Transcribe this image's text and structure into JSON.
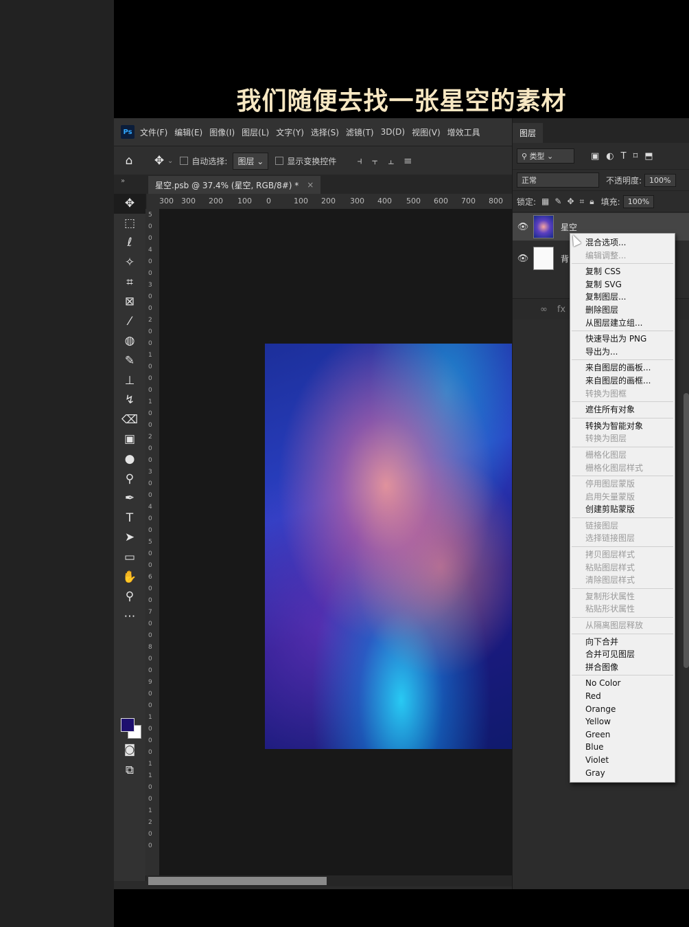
{
  "caption": "我们随便去找一张星空的素材",
  "app": {
    "logo": "Ps"
  },
  "menu": [
    "文件(F)",
    "编辑(E)",
    "图像(I)",
    "图层(L)",
    "文字(Y)",
    "选择(S)",
    "滤镜(T)",
    "3D(D)",
    "视图(V)",
    "增效工具"
  ],
  "options": {
    "auto_select_label": "自动选择:",
    "auto_select_value": "图层",
    "show_transform_label": "显示变换控件"
  },
  "doc_tab": {
    "title": "星空.psb @ 37.4% (星空, RGB/8#) *",
    "close": "×"
  },
  "ruler_top": [
    "300",
    "300",
    "200",
    "100",
    "0",
    "100",
    "200",
    "300",
    "400",
    "500",
    "600",
    "700",
    "800"
  ],
  "ruler_left": [
    "5",
    "0",
    "0",
    "4",
    "0",
    "0",
    "3",
    "0",
    "0",
    "2",
    "0",
    "0",
    "1",
    "0",
    "0",
    "0",
    "1",
    "0",
    "0",
    "2",
    "0",
    "0",
    "3",
    "0",
    "0",
    "4",
    "0",
    "0",
    "5",
    "0",
    "0",
    "6",
    "0",
    "0",
    "7",
    "0",
    "0",
    "8",
    "0",
    "0",
    "9",
    "0",
    "0",
    "1",
    "0",
    "0",
    "0",
    "1",
    "1",
    "0",
    "0",
    "1",
    "2",
    "0",
    "0"
  ],
  "layers_panel": {
    "tab": "图层",
    "filter_label": "类型",
    "blend_mode": "正常",
    "opacity_label": "不透明度:",
    "opacity_value": "100%",
    "lock_label": "锁定:",
    "fill_label": "填充:",
    "fill_value": "100%",
    "layers": [
      {
        "name": "星空"
      },
      {
        "name": "背"
      }
    ],
    "footer": [
      "∞",
      "fx"
    ]
  },
  "context_menu": [
    [
      {
        "label": "混合选项...",
        "enabled": true
      },
      {
        "label": "编辑调整...",
        "enabled": false
      }
    ],
    [
      {
        "label": "复制 CSS",
        "enabled": true
      },
      {
        "label": "复制 SVG",
        "enabled": true
      },
      {
        "label": "复制图层...",
        "enabled": true
      },
      {
        "label": "删除图层",
        "enabled": true
      },
      {
        "label": "从图层建立组...",
        "enabled": true
      }
    ],
    [
      {
        "label": "快速导出为 PNG",
        "enabled": true
      },
      {
        "label": "导出为...",
        "enabled": true
      }
    ],
    [
      {
        "label": "来自图层的画板...",
        "enabled": true
      },
      {
        "label": "来自图层的画框...",
        "enabled": true
      },
      {
        "label": "转换为图框",
        "enabled": false
      }
    ],
    [
      {
        "label": "遮住所有对象",
        "enabled": true
      }
    ],
    [
      {
        "label": "转换为智能对象",
        "enabled": true
      },
      {
        "label": "转换为图层",
        "enabled": false
      }
    ],
    [
      {
        "label": "栅格化图层",
        "enabled": false
      },
      {
        "label": "栅格化图层样式",
        "enabled": false
      }
    ],
    [
      {
        "label": "停用图层蒙版",
        "enabled": false
      },
      {
        "label": "启用矢量蒙版",
        "enabled": false
      },
      {
        "label": "创建剪贴蒙版",
        "enabled": true
      }
    ],
    [
      {
        "label": "链接图层",
        "enabled": false
      },
      {
        "label": "选择链接图层",
        "enabled": false
      }
    ],
    [
      {
        "label": "拷贝图层样式",
        "enabled": false
      },
      {
        "label": "粘贴图层样式",
        "enabled": false
      },
      {
        "label": "清除图层样式",
        "enabled": false
      }
    ],
    [
      {
        "label": "复制形状属性",
        "enabled": false
      },
      {
        "label": "粘贴形状属性",
        "enabled": false
      }
    ],
    [
      {
        "label": "从隔离图层释放",
        "enabled": false
      }
    ],
    [
      {
        "label": "向下合并",
        "enabled": true
      },
      {
        "label": "合并可见图层",
        "enabled": true
      },
      {
        "label": "拼合图像",
        "enabled": true
      }
    ],
    [
      {
        "label": "No Color",
        "enabled": true
      },
      {
        "label": "Red",
        "enabled": true
      },
      {
        "label": "Orange",
        "enabled": true
      },
      {
        "label": "Yellow",
        "enabled": true
      },
      {
        "label": "Green",
        "enabled": true
      },
      {
        "label": "Blue",
        "enabled": true
      },
      {
        "label": "Violet",
        "enabled": true
      },
      {
        "label": "Gray",
        "enabled": true
      }
    ]
  ],
  "colors": {
    "foreground": "#1d0f6e",
    "background": "#ffffff"
  }
}
